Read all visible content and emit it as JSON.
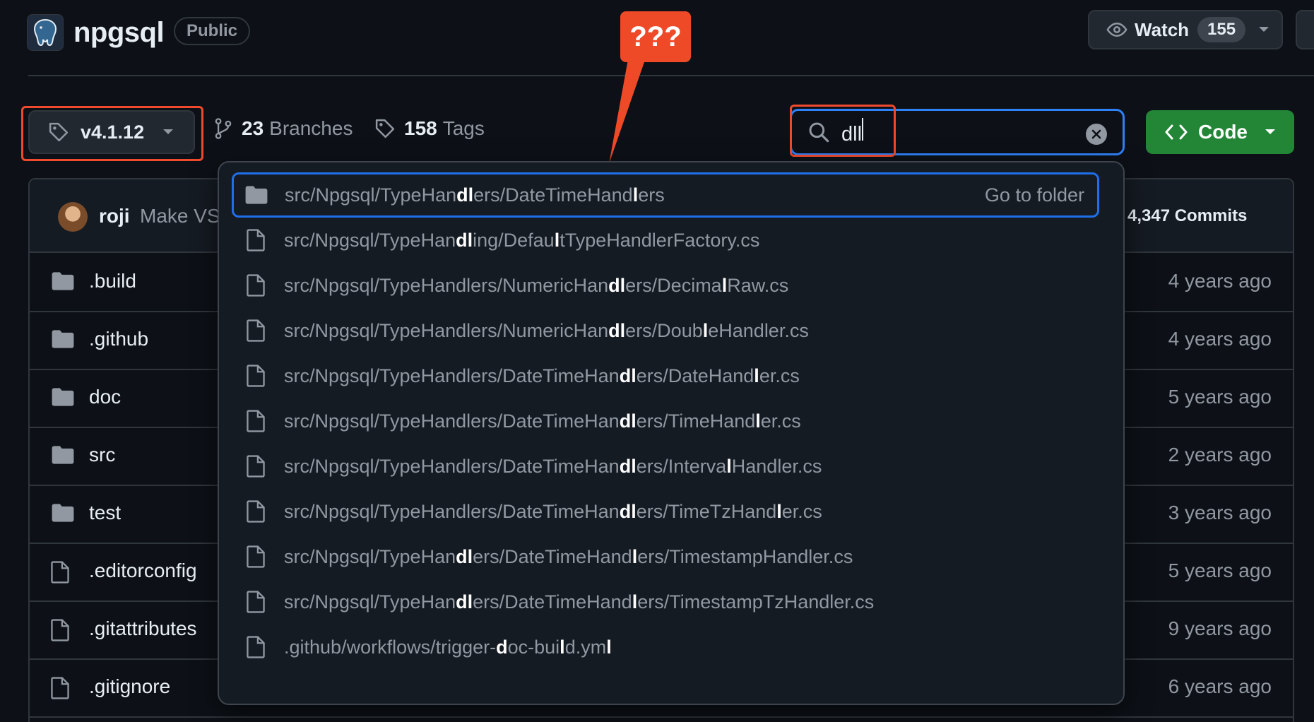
{
  "header": {
    "repo_name": "npgsql",
    "visibility_badge": "Public",
    "watch_label": "Watch",
    "watch_count": "155"
  },
  "callout": {
    "text": "???"
  },
  "toolbar": {
    "tag_label": "v4.1.12",
    "branches_count": "23",
    "branches_label": "Branches",
    "tags_count": "158",
    "tags_label": "Tags",
    "code_label": "Code"
  },
  "search": {
    "value": "dll"
  },
  "commit": {
    "author": "roji",
    "message": "Make VS",
    "count": "4,347 Commits"
  },
  "files": [
    {
      "name": ".build",
      "type": "folder",
      "time": "4 years ago"
    },
    {
      "name": ".github",
      "type": "folder",
      "time": "4 years ago"
    },
    {
      "name": "doc",
      "type": "folder",
      "time": "5 years ago"
    },
    {
      "name": "src",
      "type": "folder",
      "time": "2 years ago"
    },
    {
      "name": "test",
      "type": "folder",
      "time": "3 years ago"
    },
    {
      "name": ".editorconfig",
      "type": "file",
      "time": "5 years ago"
    },
    {
      "name": ".gitattributes",
      "type": "file",
      "time": "9 years ago"
    },
    {
      "name": ".gitignore",
      "type": "file",
      "time": "6 years ago"
    }
  ],
  "results": [
    {
      "type": "folder",
      "action": "Go to folder",
      "segments": [
        [
          "src/Npgsql/TypeHan",
          0
        ],
        [
          "dl",
          1
        ],
        [
          "ers/DateTimeHand",
          0
        ],
        [
          "l",
          1
        ],
        [
          "ers",
          0
        ]
      ]
    },
    {
      "type": "file",
      "segments": [
        [
          "src/Npgsql/TypeHan",
          0
        ],
        [
          "dl",
          1
        ],
        [
          "ing/Defau",
          0
        ],
        [
          "l",
          1
        ],
        [
          "tTypeHandlerFactory.cs",
          0
        ]
      ]
    },
    {
      "type": "file",
      "segments": [
        [
          "src/Npgsql/TypeHandlers/NumericHan",
          0
        ],
        [
          "dl",
          1
        ],
        [
          "ers/Decima",
          0
        ],
        [
          "l",
          1
        ],
        [
          "Raw.cs",
          0
        ]
      ]
    },
    {
      "type": "file",
      "segments": [
        [
          "src/Npgsql/TypeHandlers/NumericHan",
          0
        ],
        [
          "dl",
          1
        ],
        [
          "ers/Doub",
          0
        ],
        [
          "l",
          1
        ],
        [
          "eHandler.cs",
          0
        ]
      ]
    },
    {
      "type": "file",
      "segments": [
        [
          "src/Npgsql/TypeHandlers/DateTimeHan",
          0
        ],
        [
          "dl",
          1
        ],
        [
          "ers/DateHand",
          0
        ],
        [
          "l",
          1
        ],
        [
          "er.cs",
          0
        ]
      ]
    },
    {
      "type": "file",
      "segments": [
        [
          "src/Npgsql/TypeHandlers/DateTimeHan",
          0
        ],
        [
          "dl",
          1
        ],
        [
          "ers/TimeHand",
          0
        ],
        [
          "l",
          1
        ],
        [
          "er.cs",
          0
        ]
      ]
    },
    {
      "type": "file",
      "segments": [
        [
          "src/Npgsql/TypeHandlers/DateTimeHan",
          0
        ],
        [
          "dl",
          1
        ],
        [
          "ers/Interva",
          0
        ],
        [
          "l",
          1
        ],
        [
          "Handler.cs",
          0
        ]
      ]
    },
    {
      "type": "file",
      "segments": [
        [
          "src/Npgsql/TypeHandlers/DateTimeHan",
          0
        ],
        [
          "dl",
          1
        ],
        [
          "ers/TimeTzHand",
          0
        ],
        [
          "l",
          1
        ],
        [
          "er.cs",
          0
        ]
      ]
    },
    {
      "type": "file",
      "segments": [
        [
          "src/Npgsql/TypeHan",
          0
        ],
        [
          "dl",
          1
        ],
        [
          "ers/DateTimeHand",
          0
        ],
        [
          "l",
          1
        ],
        [
          "ers/TimestampHandler.cs",
          0
        ]
      ]
    },
    {
      "type": "file",
      "segments": [
        [
          "src/Npgsql/TypeHan",
          0
        ],
        [
          "dl",
          1
        ],
        [
          "ers/DateTimeHand",
          0
        ],
        [
          "l",
          1
        ],
        [
          "ers/TimestampTzHandler.cs",
          0
        ]
      ]
    },
    {
      "type": "file",
      "segments": [
        [
          ".github/workflows/trigger-",
          0
        ],
        [
          "d",
          1
        ],
        [
          "oc-bui",
          0
        ],
        [
          "l",
          1
        ],
        [
          "d.ym",
          0
        ],
        [
          "l",
          1
        ]
      ]
    }
  ],
  "colors": {
    "accent_blue": "#2f81f7",
    "annotation_red": "#ef4a2d",
    "code_green": "#238636",
    "background": "#0d1117"
  }
}
